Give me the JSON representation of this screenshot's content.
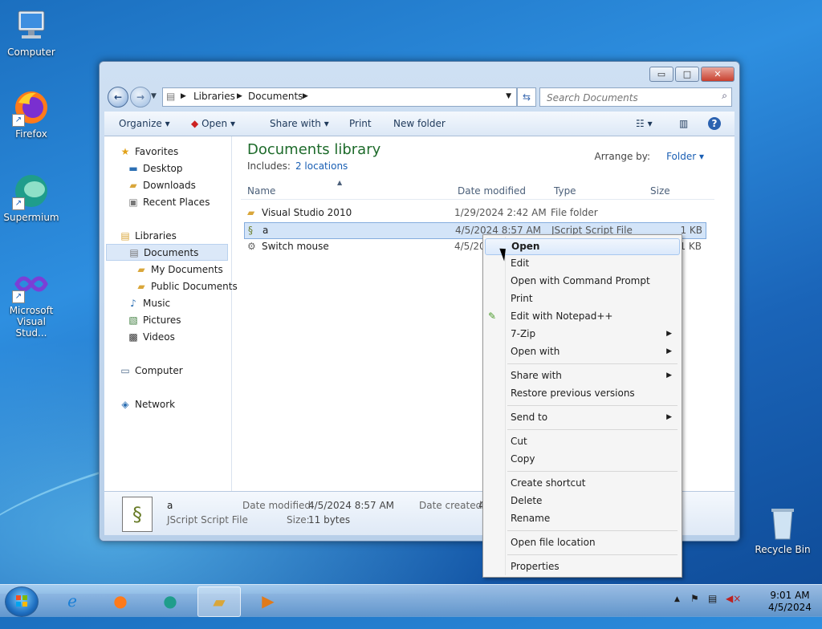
{
  "desktop": {
    "icons": [
      {
        "label": "Computer"
      },
      {
        "label": "Firefox"
      },
      {
        "label": "Supermium"
      },
      {
        "label": "Microsoft Visual Stud..."
      },
      {
        "label": "Recycle Bin"
      }
    ]
  },
  "window": {
    "caption_buttons": {
      "minimize": "▭",
      "maximize": "□",
      "close": "✕"
    },
    "address": {
      "segments": [
        "Libraries",
        "Documents"
      ]
    },
    "search": {
      "placeholder": "Search Documents"
    },
    "commands": {
      "organize": "Organize",
      "open": "Open",
      "share_with": "Share with",
      "print": "Print",
      "new_folder": "New folder"
    },
    "nav": {
      "favorites": "Favorites",
      "desktop": "Desktop",
      "downloads": "Downloads",
      "recent_places": "Recent Places",
      "libraries": "Libraries",
      "documents": "Documents",
      "my_documents": "My Documents",
      "public_documents": "Public Documents",
      "music": "Music",
      "pictures": "Pictures",
      "videos": "Videos",
      "computer": "Computer",
      "network": "Network"
    },
    "library": {
      "title": "Documents library",
      "includes_label": "Includes:",
      "includes_link": "2 locations",
      "arrange_label": "Arrange by:",
      "arrange_value": "Folder"
    },
    "columns": {
      "name": "Name",
      "date": "Date modified",
      "type": "Type",
      "size": "Size"
    },
    "files": [
      {
        "name": "Visual Studio 2010",
        "date": "1/29/2024 2:42 AM",
        "type": "File folder",
        "size": ""
      },
      {
        "name": "a",
        "date": "4/5/2024 8:57 AM",
        "type": "JScript Script File",
        "size": "1 KB"
      },
      {
        "name": "Switch mouse",
        "date": "4/5/20",
        "type": "",
        "size": "1 KB"
      }
    ],
    "details": {
      "name": "a",
      "type": "JScript Script File",
      "date_modified_label": "Date modified:",
      "date_modified": "4/5/2024 8:57 AM",
      "size_label": "Size:",
      "size": "11 bytes",
      "date_created_label": "Date created:",
      "date_created": "4"
    }
  },
  "context_menu": {
    "open": "Open",
    "edit": "Edit",
    "open_cmd": "Open with Command Prompt",
    "print": "Print",
    "notepad": "Edit with Notepad++",
    "zip": "7-Zip",
    "open_with": "Open with",
    "share_with": "Share with",
    "restore": "Restore previous versions",
    "send_to": "Send to",
    "cut": "Cut",
    "copy": "Copy",
    "create_shortcut": "Create shortcut",
    "delete": "Delete",
    "rename": "Rename",
    "open_location": "Open file location",
    "properties": "Properties"
  },
  "taskbar": {
    "clock_time": "9:01 AM",
    "clock_date": "4/5/2024"
  }
}
